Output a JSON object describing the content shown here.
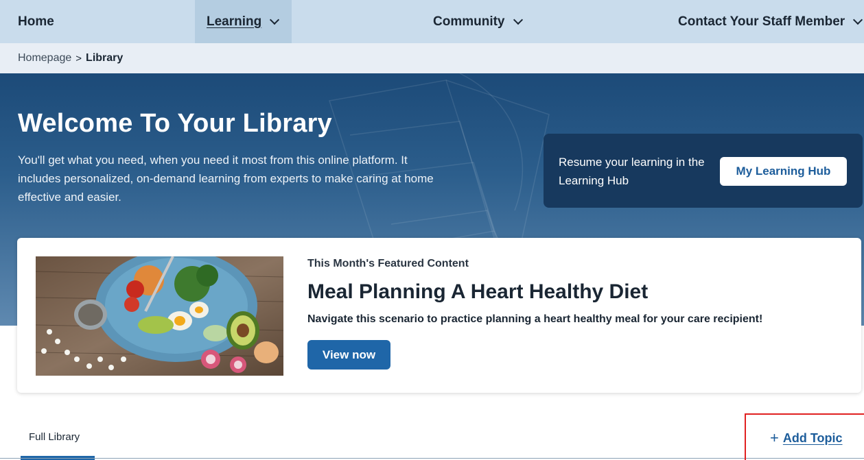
{
  "nav": {
    "home": "Home",
    "learning": "Learning",
    "community": "Community",
    "contact": "Contact Your Staff Member"
  },
  "breadcrumb": {
    "root": "Homepage",
    "separator": ">",
    "current": "Library"
  },
  "hero": {
    "title": "Welcome To Your Library",
    "description": "You'll get what you need, when you need it most from this online platform. It includes personalized, on-demand learning from experts to make caring at home effective and easier.",
    "resume_text": "Resume your learning in the Learning Hub",
    "hub_button": "My Learning Hub"
  },
  "featured": {
    "label": "This Month's Featured Content",
    "title": "Meal Planning A Heart Healthy Diet",
    "description": "Navigate this scenario to practice planning a heart healthy meal for your care recipient!",
    "button": "View now",
    "image_icon": "food-bowl-photo"
  },
  "tabs": {
    "full_library": "Full Library"
  },
  "actions": {
    "add_topic": "Add Topic",
    "add_icon": "+"
  },
  "colors": {
    "nav_bg": "#c9dcec",
    "hero_top": "#1c4a78",
    "accent": "#1f66a8",
    "highlight": "#e02020"
  }
}
